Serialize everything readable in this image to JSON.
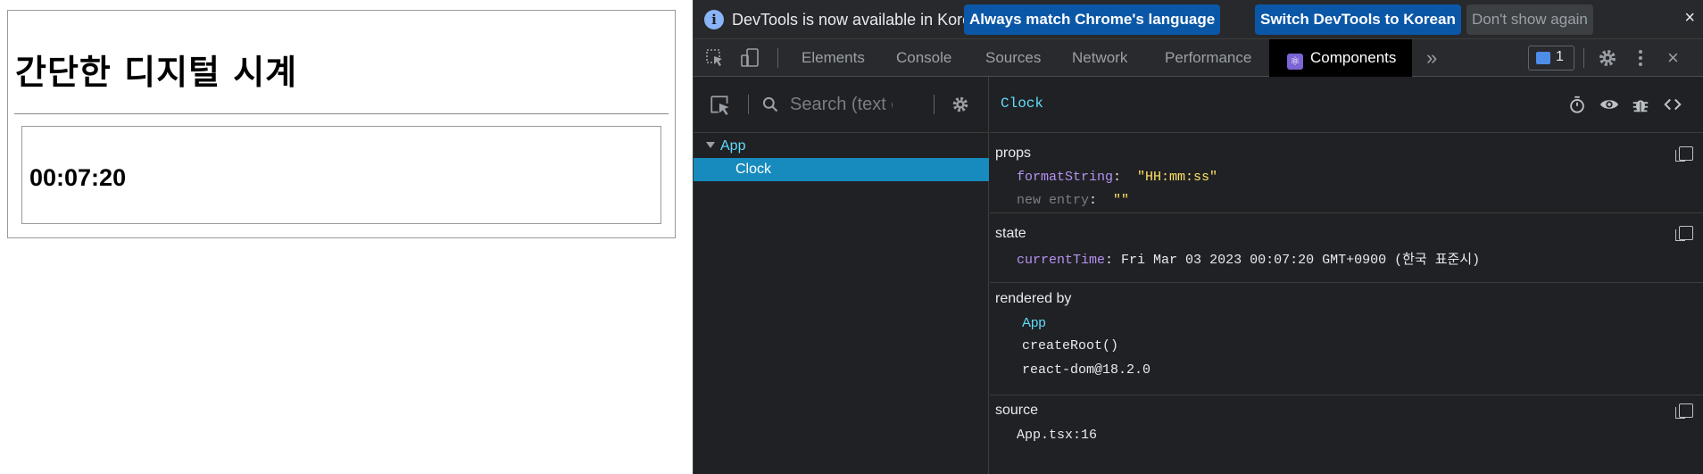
{
  "page": {
    "title": "간단한 디지털 시계",
    "clock_time": "00:07:20"
  },
  "devtools": {
    "infobar": {
      "message": "DevTools is now available in Korean!",
      "btn_match": "Always match Chrome's language",
      "btn_switch": "Switch DevTools to Korean",
      "btn_dismiss": "Don't show again",
      "close": "×"
    },
    "tabs": [
      "Elements",
      "Console",
      "Sources",
      "Network",
      "Performance",
      "Components"
    ],
    "active_tab": "Components",
    "more_tabs": "»",
    "issues_count": "1",
    "close": "×",
    "search_placeholder": "Search (text or /regex/)",
    "tree": {
      "root": "App",
      "selected": "Clock"
    },
    "detail": {
      "component_name": "Clock",
      "props_title": "props",
      "props": [
        {
          "key": "formatString",
          "value": "\"HH:mm:ss\""
        },
        {
          "key": "new entry",
          "value": "\"\""
        }
      ],
      "state_title": "state",
      "state": [
        {
          "key": "currentTime",
          "value": "Fri Mar 03 2023 00:07:20 GMT+0900 (한국 표준시)"
        }
      ],
      "rendered_by_title": "rendered by",
      "rendered_by": [
        "App",
        "createRoot()",
        "react-dom@18.2.0"
      ],
      "source_title": "source",
      "source": "App.tsx:16"
    },
    "colors": {
      "bg": "#202124",
      "react_blue": "#61dafb",
      "selected_row": "#178bbd",
      "primary_button": "#0b57a7"
    }
  }
}
